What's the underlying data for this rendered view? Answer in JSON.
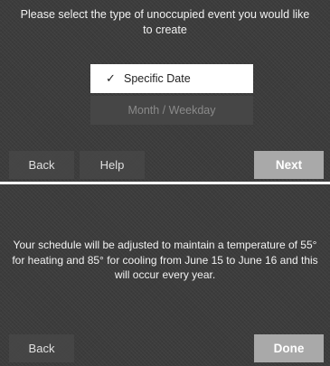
{
  "screen1": {
    "prompt": "Please select the type of unoccupied event you would like to create",
    "options": [
      {
        "check": "✓",
        "label": "Specific Date",
        "selected": true
      },
      {
        "label": "Month / Weekday",
        "selected": false
      }
    ],
    "buttons": {
      "back": "Back",
      "help": "Help",
      "next": "Next"
    }
  },
  "screen2": {
    "message": "Your schedule will be adjusted to maintain a temperature of 55° for heating and 85° for cooling from June 15 to June 16 and this will occur every year.",
    "buttons": {
      "back": "Back",
      "done": "Done"
    }
  },
  "colors": {
    "background": "#3c3c3c",
    "selected_option": "#ffffff",
    "unselected_option": "#464646",
    "primary_button": "#a9a9a9"
  }
}
